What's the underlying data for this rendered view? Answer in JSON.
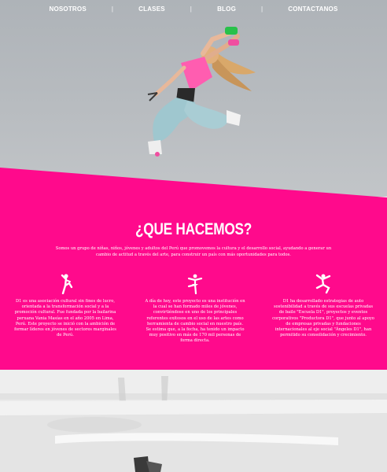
{
  "nav": {
    "items": [
      "NOSOTROS",
      "CLASES",
      "BLOG",
      "CONTACTANOS"
    ],
    "separator": "|"
  },
  "section": {
    "title": "¿QUE HACEMOS?",
    "intro": "Somos un grupo de niñas, niños, jóvenes y adultos del Perú que promovemos la cultura y el desarrollo social, ayudando a generar un cambio de actitud a través del arte, para construir un país con más oportunidades para todos.",
    "columns": [
      {
        "icon": "dancer-pose-icon",
        "text": "D1 es una asociación cultural sin fines de lucro, orientada a la transformación social y a la promoción cultural. Fue fundada por la bailarina peruana Vania Masías en el año 2005 en Lima, Perú. Este proyecto se inició con la ambición de formar líderes en jóvenes de sectores marginales de Perú."
      },
      {
        "icon": "ballet-dancer-icon",
        "text": "A día de hoy, este proyecto es una institución en la cual se han formado miles de jóvenes, convirtiéndose en uno de los principales referentes exitosos en el uso de las artes como herramienta de cambio social en nuestro país. Se estima que, a la fecha, ha tenido un impacto muy positivo en más de 170 mil personas de forma directa."
      },
      {
        "icon": "jumping-dancer-icon",
        "text": "D1 ha desarrollado estrategias de auto sostenibilidad a través de sus escuelas privadas de baile \"Escuela D1\", proyectos y eventos corporativos \"Productora D1\", que junto al apoyo de empresas privadas y fundaciones internacionales al eje social \"Ángeles D1\", han permitido su consolidación y crecimiento."
      }
    ]
  },
  "colors": {
    "accent": "#ff0a8c",
    "hero_bg": "#b3b7bb"
  }
}
